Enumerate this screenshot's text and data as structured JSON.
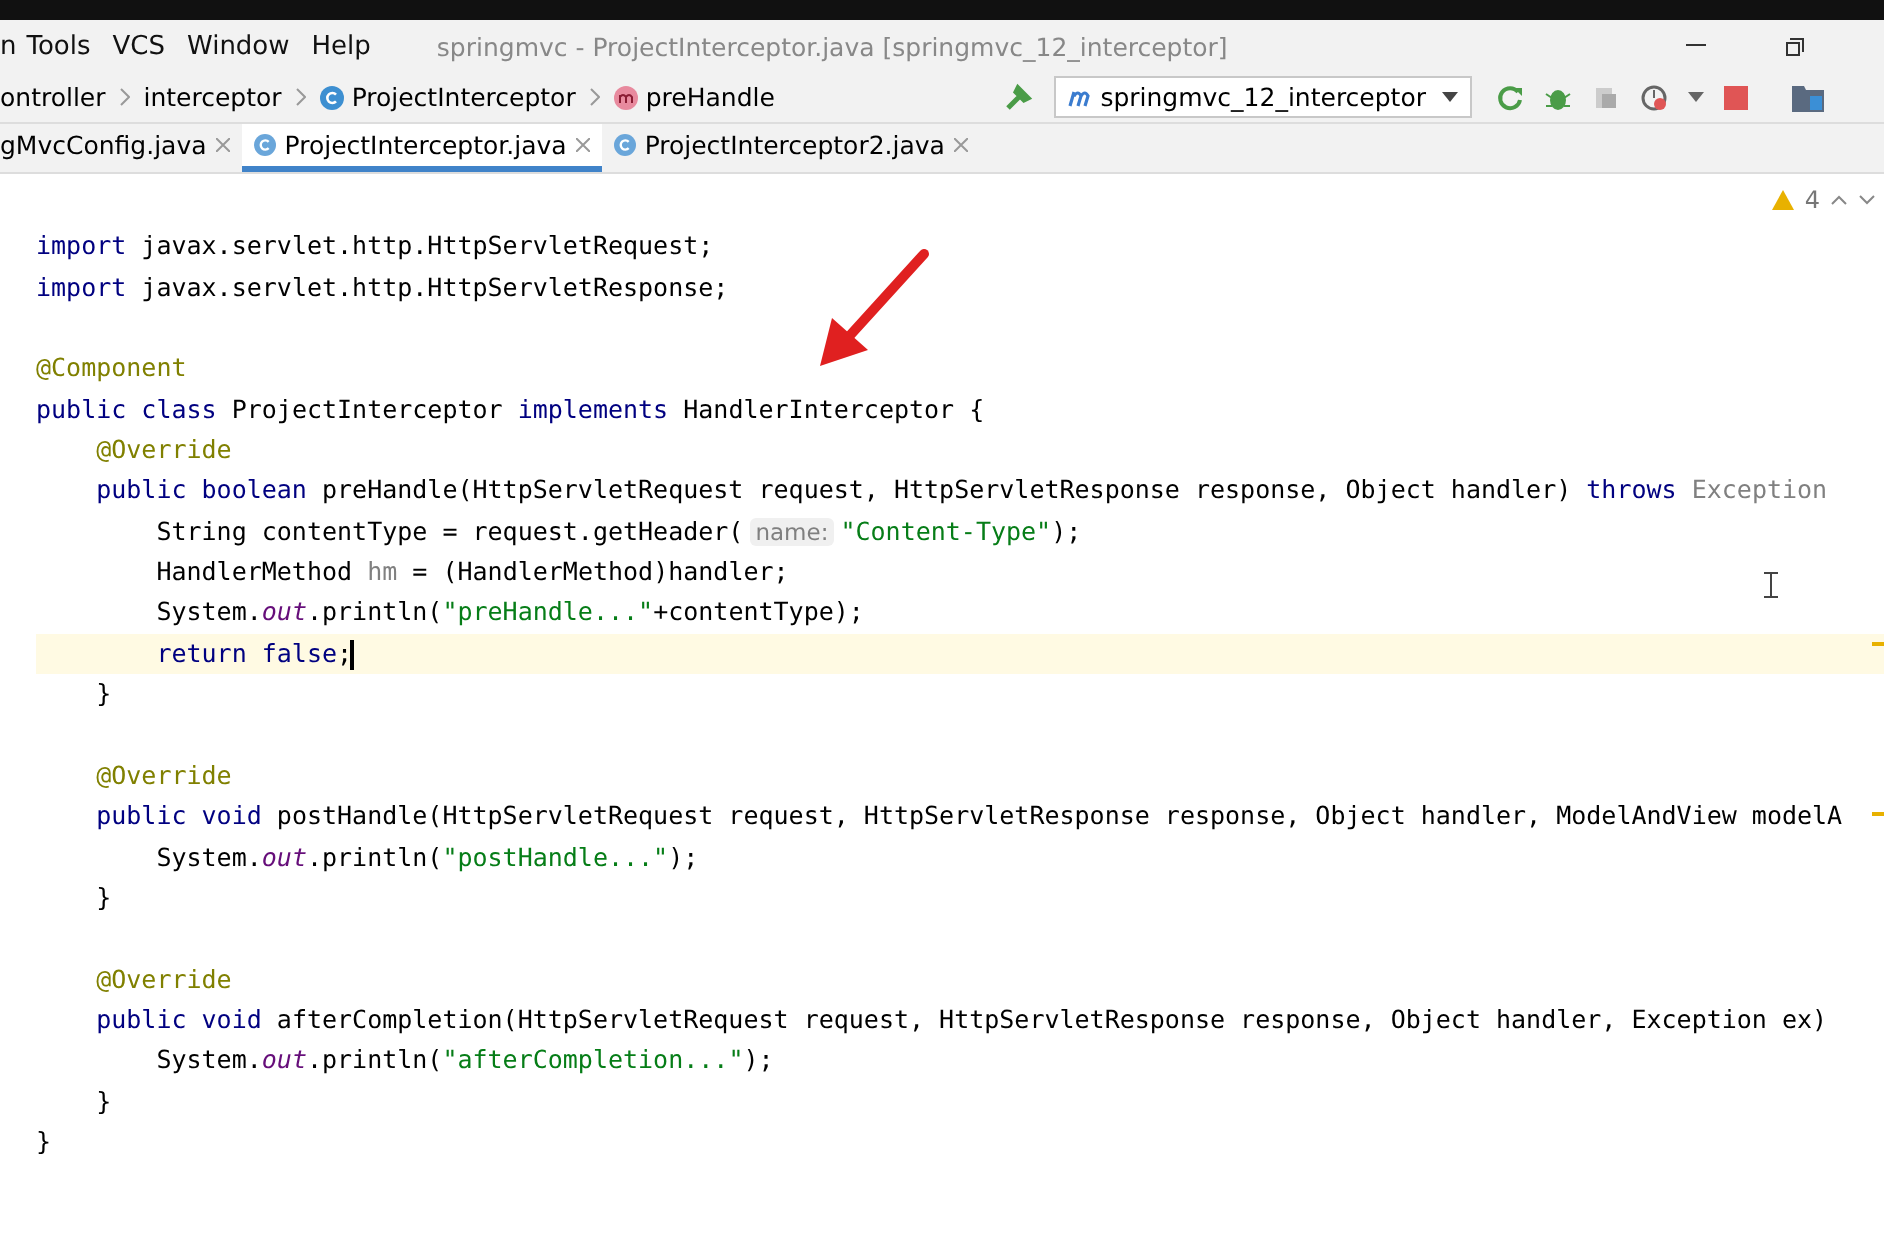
{
  "menu_bar": {
    "items": [
      "n",
      "Tools",
      "VCS",
      "Window",
      "Help"
    ],
    "title": "springmvc - ProjectInterceptor.java [springmvc_12_interceptor]"
  },
  "breadcrumb": [
    {
      "kind": "folder",
      "label": "ontroller"
    },
    {
      "kind": "folder",
      "label": "interceptor"
    },
    {
      "kind": "class",
      "label": "ProjectInterceptor"
    },
    {
      "kind": "method",
      "label": "preHandle"
    }
  ],
  "run_config": "springmvc_12_interceptor",
  "tabs": [
    {
      "label": "gMvcConfig.java",
      "selected": false,
      "icon": false
    },
    {
      "label": "ProjectInterceptor.java",
      "selected": true,
      "icon": true
    },
    {
      "label": "ProjectInterceptor2.java",
      "selected": false,
      "icon": true
    }
  ],
  "inspections": {
    "warnings": "4"
  },
  "code_lines": [
    {
      "current": false
    },
    {
      "current": false,
      "tokens": [
        {
          "kind": "keyword",
          "t": "import"
        },
        {
          "kind": "plain",
          "t": " javax.servlet.http.HttpServletRequest;"
        }
      ]
    },
    {
      "current": false,
      "tokens": [
        {
          "kind": "keyword",
          "t": "import"
        },
        {
          "kind": "plain",
          "t": " javax.servlet.http.HttpServletResponse;"
        }
      ]
    },
    {
      "current": false
    },
    {
      "current": false,
      "tokens": [
        {
          "kind": "annotation",
          "t": "@Component"
        }
      ]
    },
    {
      "current": false,
      "tokens": [
        {
          "kind": "keyword",
          "t": "public class"
        },
        {
          "kind": "plain",
          "t": " ProjectInterceptor "
        },
        {
          "kind": "keyword",
          "t": "implements"
        },
        {
          "kind": "plain",
          "t": " HandlerInterceptor {"
        }
      ]
    },
    {
      "current": false,
      "tokens": [
        {
          "kind": "annotation",
          "t": "    @Override"
        }
      ]
    },
    {
      "current": false,
      "tokens": [
        {
          "kind": "keyword",
          "t": "    public boolean"
        },
        {
          "kind": "plain",
          "t": " preHandle(HttpServletRequest request, HttpServletResponse response, Object handler) "
        },
        {
          "kind": "keyword",
          "t": "throws"
        },
        {
          "kind": "unused",
          "t": " Exception"
        }
      ]
    },
    {
      "current": false,
      "tokens": [
        {
          "kind": "plain",
          "t": "        String contentType = request.getHeader("
        },
        {
          "kind": "hint",
          "t": "name:"
        },
        {
          "kind": "string",
          "t": "\"Content-Type\""
        },
        {
          "kind": "plain",
          "t": ");"
        }
      ]
    },
    {
      "current": false,
      "tokens": [
        {
          "kind": "plain",
          "t": "        HandlerMethod "
        },
        {
          "kind": "unused",
          "t": "hm"
        },
        {
          "kind": "plain",
          "t": " = (HandlerMethod)handler;"
        }
      ]
    },
    {
      "current": false,
      "tokens": [
        {
          "kind": "plain",
          "t": "        System."
        },
        {
          "kind": "static",
          "t": "out"
        },
        {
          "kind": "plain",
          "t": ".println("
        },
        {
          "kind": "string",
          "t": "\"preHandle...\""
        },
        {
          "kind": "plain",
          "t": "+contentType);"
        }
      ]
    },
    {
      "current": true,
      "tokens": [
        {
          "kind": "keyword",
          "t": "        return false"
        },
        {
          "kind": "plain",
          "t": ";"
        }
      ]
    },
    {
      "current": false,
      "tokens": [
        {
          "kind": "plain",
          "t": "    }"
        }
      ]
    },
    {
      "current": false
    },
    {
      "current": false,
      "tokens": [
        {
          "kind": "annotation",
          "t": "    @Override"
        }
      ]
    },
    {
      "current": false,
      "tokens": [
        {
          "kind": "keyword",
          "t": "    public void"
        },
        {
          "kind": "plain",
          "t": " postHandle(HttpServletRequest request, HttpServletResponse response, Object handler, ModelAndView modelA"
        }
      ]
    },
    {
      "current": false,
      "tokens": [
        {
          "kind": "plain",
          "t": "        System."
        },
        {
          "kind": "static",
          "t": "out"
        },
        {
          "kind": "plain",
          "t": ".println("
        },
        {
          "kind": "string",
          "t": "\"postHandle...\""
        },
        {
          "kind": "plain",
          "t": ");"
        }
      ]
    },
    {
      "current": false,
      "tokens": [
        {
          "kind": "plain",
          "t": "    }"
        }
      ]
    },
    {
      "current": false
    },
    {
      "current": false,
      "tokens": [
        {
          "kind": "annotation",
          "t": "    @Override"
        }
      ]
    },
    {
      "current": false,
      "tokens": [
        {
          "kind": "keyword",
          "t": "    public void"
        },
        {
          "kind": "plain",
          "t": " afterCompletion(HttpServletRequest request, HttpServletResponse response, Object handler, Exception ex)"
        }
      ]
    },
    {
      "current": false,
      "tokens": [
        {
          "kind": "plain",
          "t": "        System."
        },
        {
          "kind": "static",
          "t": "out"
        },
        {
          "kind": "plain",
          "t": ".println("
        },
        {
          "kind": "string",
          "t": "\"afterCompletion...\""
        },
        {
          "kind": "plain",
          "t": ");"
        }
      ]
    },
    {
      "current": false,
      "tokens": [
        {
          "kind": "plain",
          "t": "    }"
        }
      ]
    },
    {
      "current": false,
      "tokens": [
        {
          "kind": "plain",
          "t": "}"
        }
      ]
    }
  ]
}
